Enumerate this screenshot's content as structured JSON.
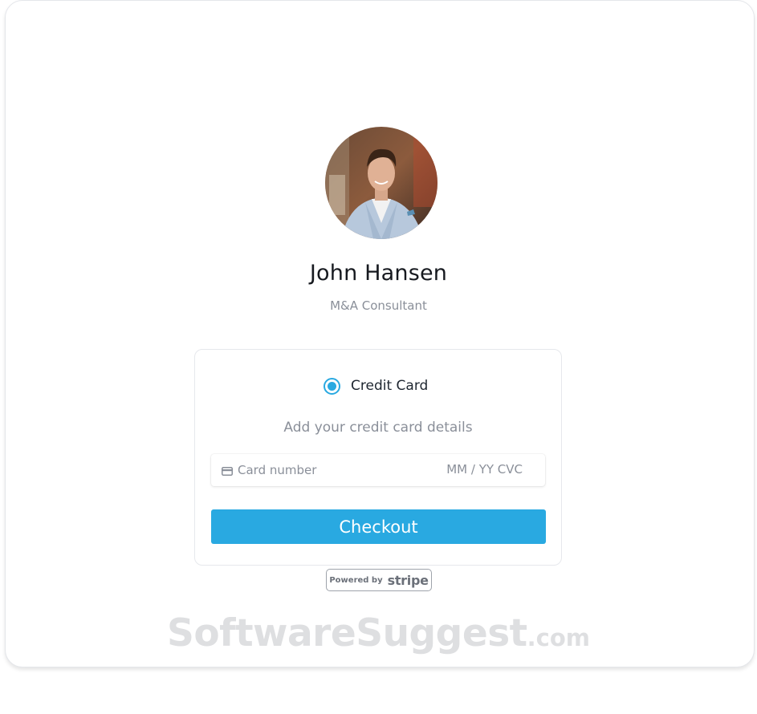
{
  "profile": {
    "name": "John Hansen",
    "role": "M&A Consultant"
  },
  "payment": {
    "method_label": "Credit Card",
    "method_selected": true,
    "instructions": "Add your credit card details",
    "card_number_placeholder": "Card number",
    "expiry_cvc_placeholder": "MM / YY CVC",
    "checkout_label": "Checkout"
  },
  "badge": {
    "powered_by": "Powered by",
    "brand": "stripe"
  },
  "watermark": {
    "main": "SoftwareSuggest",
    "suffix": ".com"
  },
  "icons": {
    "card": "credit-card-icon",
    "radio": "radio-selected-icon"
  },
  "colors": {
    "accent": "#29a9e1",
    "text_primary": "#16191f",
    "text_muted": "#8a8f99"
  }
}
